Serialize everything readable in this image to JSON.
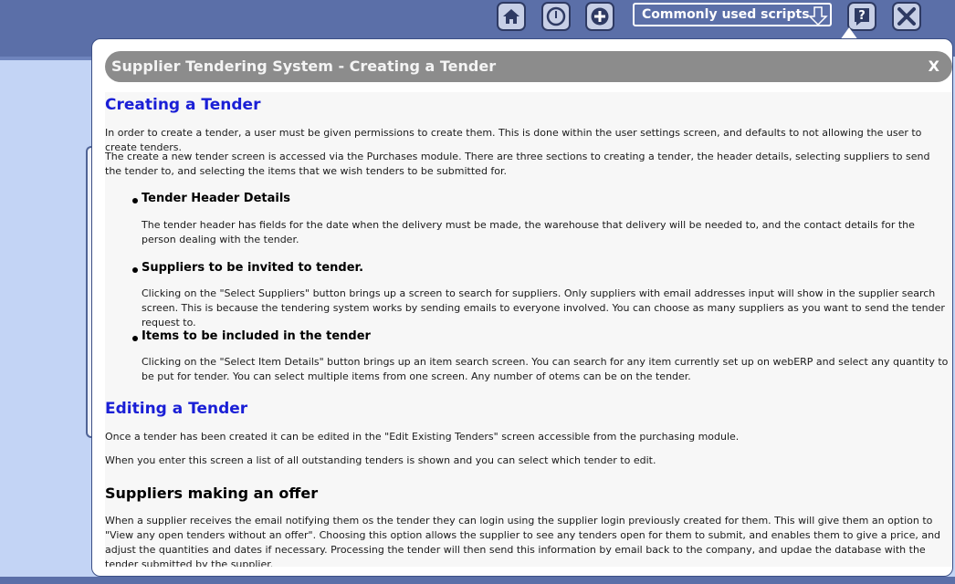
{
  "toolbar": {
    "home": "home-icon",
    "dashboard": "dashboard-icon",
    "add": "add-icon",
    "scripts_select": "Commonly used scripts",
    "help": "help-icon",
    "close": "close-icon"
  },
  "dialog": {
    "title": "Supplier Tendering System - Creating a Tender",
    "close_label": "X"
  },
  "help": {
    "creating_heading": "Creating a Tender",
    "creating_p1": "In order to create a tender, a user must be given permissions to create them. This is done within the user settings screen, and defaults to not allowing the user to create tenders.",
    "creating_p2": "The create a new tender screen is accessed via the Purchases module. There are three sections to creating a tender, the header details, selecting suppliers to send the tender to, and selecting the items that we wish tenders to be submitted for.",
    "sections": [
      {
        "title": "Tender Header Details",
        "text": "The tender header has fields for the date when the delivery must be made, the warehouse that delivery will be needed to, and the contact details for the person dealing with the tender."
      },
      {
        "title": "Suppliers to be invited to tender.",
        "text": "Clicking on the \"Select Suppliers\" button brings up a screen to search for suppliers. Only suppliers with email addresses input will show in the supplier search screen. This is because the tendering system works by sending emails to everyone involved. You can choose as many suppliers as you want to send the tender request to."
      },
      {
        "title": "Items to be included in the tender",
        "text": "Clicking on the \"Select Item Details\" button brings up an item search screen. You can search for any item currently set up on webERP and select any quantity to be put for tender. You can select multiple items from one screen. Any number of otems can be on the tender."
      }
    ],
    "editing_heading": "Editing a Tender",
    "editing_p1": "Once a tender has been created it can be edited in the \"Edit Existing Tenders\" screen accessible from the purchasing module.",
    "editing_p2": "When you enter this screen a list of all outstanding tenders is shown and you can select which tender to edit.",
    "offer_heading": "Suppliers making an offer",
    "offer_p1": "When a supplier receives the email notifying them os the tender they can login using the supplier login previously created for them. This will give them an option to \"View any open tenders without an offer\". Choosing this option allows the supplier to see any tenders open for them to submit, and enables them to give a price, and adjust the quantities and dates if necessary. Processing the tender will then send this information by email back to the company, and updae the database with the tender submitted by the supplier."
  }
}
